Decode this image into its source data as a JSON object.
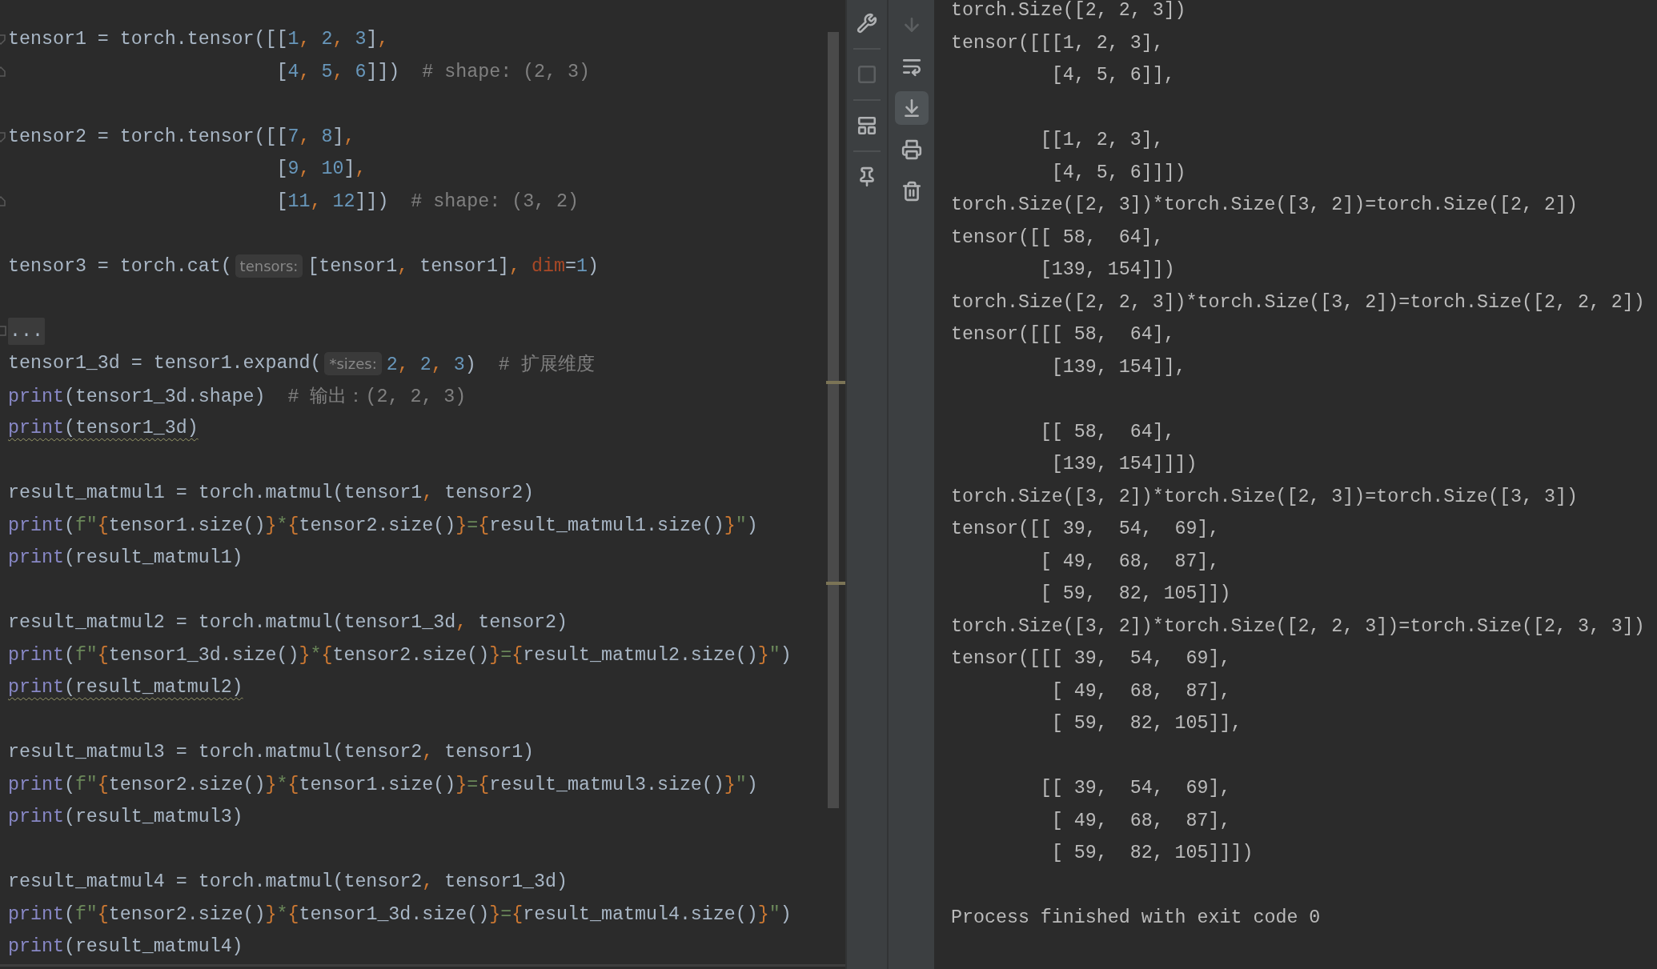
{
  "editor": {
    "lines": [
      {
        "kind": "code",
        "fold_start": true,
        "tokens": [
          {
            "kind": "plain",
            "text": "tensor1 = torch.tensor([["
          },
          {
            "kind": "number",
            "text": "1"
          },
          {
            "kind": "comma",
            "text": ", "
          },
          {
            "kind": "number",
            "text": "2"
          },
          {
            "kind": "comma",
            "text": ", "
          },
          {
            "kind": "number",
            "text": "3"
          },
          {
            "kind": "plain",
            "text": "]"
          },
          {
            "kind": "comma",
            "text": ","
          }
        ]
      },
      {
        "kind": "code",
        "fold_end": true,
        "tokens": [
          {
            "kind": "plain",
            "text": "                        ["
          },
          {
            "kind": "number",
            "text": "4"
          },
          {
            "kind": "comma",
            "text": ", "
          },
          {
            "kind": "number",
            "text": "5"
          },
          {
            "kind": "comma",
            "text": ", "
          },
          {
            "kind": "number",
            "text": "6"
          },
          {
            "kind": "plain",
            "text": "]])"
          },
          {
            "kind": "comment",
            "text": "  # shape: (2, 3)"
          }
        ]
      },
      {
        "kind": "blank"
      },
      {
        "kind": "code",
        "fold_start": true,
        "tokens": [
          {
            "kind": "plain",
            "text": "tensor2 = torch.tensor([["
          },
          {
            "kind": "number",
            "text": "7"
          },
          {
            "kind": "comma",
            "text": ", "
          },
          {
            "kind": "number",
            "text": "8"
          },
          {
            "kind": "plain",
            "text": "]"
          },
          {
            "kind": "comma",
            "text": ","
          }
        ]
      },
      {
        "kind": "code",
        "tokens": [
          {
            "kind": "plain",
            "text": "                        ["
          },
          {
            "kind": "number",
            "text": "9"
          },
          {
            "kind": "comma",
            "text": ", "
          },
          {
            "kind": "number",
            "text": "10"
          },
          {
            "kind": "plain",
            "text": "]"
          },
          {
            "kind": "comma",
            "text": ","
          }
        ]
      },
      {
        "kind": "code",
        "fold_end": true,
        "tokens": [
          {
            "kind": "plain",
            "text": "                        ["
          },
          {
            "kind": "number",
            "text": "11"
          },
          {
            "kind": "comma",
            "text": ", "
          },
          {
            "kind": "number",
            "text": "12"
          },
          {
            "kind": "plain",
            "text": "]])"
          },
          {
            "kind": "comment",
            "text": "  # shape: (3, 2)"
          }
        ]
      },
      {
        "kind": "blank"
      },
      {
        "kind": "code",
        "tokens": [
          {
            "kind": "plain",
            "text": "tensor3 = torch.cat("
          },
          {
            "kind": "hint",
            "text": "tensors:"
          },
          {
            "kind": "plain",
            "text": "[tensor1"
          },
          {
            "kind": "comma",
            "text": ", "
          },
          {
            "kind": "plain",
            "text": "tensor1]"
          },
          {
            "kind": "comma",
            "text": ", "
          },
          {
            "kind": "param",
            "text": "dim"
          },
          {
            "kind": "plain",
            "text": "="
          },
          {
            "kind": "number",
            "text": "1"
          },
          {
            "kind": "plain",
            "text": ")"
          }
        ]
      },
      {
        "kind": "blank"
      },
      {
        "kind": "code",
        "folded": true,
        "tokens": [
          {
            "kind": "fold",
            "text": "..."
          }
        ]
      },
      {
        "kind": "code",
        "tokens": [
          {
            "kind": "plain",
            "text": "tensor1_3d = tensor1.expand("
          },
          {
            "kind": "hint",
            "text": "*sizes:"
          },
          {
            "kind": "number",
            "text": "2"
          },
          {
            "kind": "comma",
            "text": ", "
          },
          {
            "kind": "number",
            "text": "2"
          },
          {
            "kind": "comma",
            "text": ", "
          },
          {
            "kind": "number",
            "text": "3"
          },
          {
            "kind": "plain",
            "text": ")"
          },
          {
            "kind": "comment",
            "text": "  # 扩展维度"
          }
        ]
      },
      {
        "kind": "code",
        "tokens": [
          {
            "kind": "builtin",
            "text": "print"
          },
          {
            "kind": "plain",
            "text": "(tensor1_3d.shape)"
          },
          {
            "kind": "comment",
            "text": "  # 输出：(2, 2, 3)"
          }
        ]
      },
      {
        "kind": "code",
        "warning": true,
        "tokens": [
          {
            "kind": "builtin",
            "text": "print"
          },
          {
            "kind": "plain",
            "text": "(tensor1_3d)"
          }
        ]
      },
      {
        "kind": "blank"
      },
      {
        "kind": "code",
        "tokens": [
          {
            "kind": "plain",
            "text": "result_matmul1 = torch.matmul(tensor1"
          },
          {
            "kind": "comma",
            "text": ", "
          },
          {
            "kind": "plain",
            "text": "tensor2)"
          }
        ]
      },
      {
        "kind": "code",
        "tokens": [
          {
            "kind": "builtin",
            "text": "print"
          },
          {
            "kind": "plain",
            "text": "("
          },
          {
            "kind": "string",
            "text": "f\""
          },
          {
            "kind": "brace",
            "text": "{"
          },
          {
            "kind": "plain",
            "text": "tensor1.size()"
          },
          {
            "kind": "brace",
            "text": "}"
          },
          {
            "kind": "string",
            "text": "*"
          },
          {
            "kind": "brace",
            "text": "{"
          },
          {
            "kind": "plain",
            "text": "tensor2.size()"
          },
          {
            "kind": "brace",
            "text": "}"
          },
          {
            "kind": "string",
            "text": "="
          },
          {
            "kind": "brace",
            "text": "{"
          },
          {
            "kind": "plain",
            "text": "result_matmul1.size()"
          },
          {
            "kind": "brace",
            "text": "}"
          },
          {
            "kind": "string",
            "text": "\""
          },
          {
            "kind": "plain",
            "text": ")"
          }
        ]
      },
      {
        "kind": "code",
        "tokens": [
          {
            "kind": "builtin",
            "text": "print"
          },
          {
            "kind": "plain",
            "text": "(result_matmul1)"
          }
        ]
      },
      {
        "kind": "blank"
      },
      {
        "kind": "code",
        "tokens": [
          {
            "kind": "plain",
            "text": "result_matmul2 = torch.matmul(tensor1_3d"
          },
          {
            "kind": "comma",
            "text": ", "
          },
          {
            "kind": "plain",
            "text": "tensor2)"
          }
        ]
      },
      {
        "kind": "code",
        "tokens": [
          {
            "kind": "builtin",
            "text": "print"
          },
          {
            "kind": "plain",
            "text": "("
          },
          {
            "kind": "string",
            "text": "f\""
          },
          {
            "kind": "brace",
            "text": "{"
          },
          {
            "kind": "plain",
            "text": "tensor1_3d.size()"
          },
          {
            "kind": "brace",
            "text": "}"
          },
          {
            "kind": "string",
            "text": "*"
          },
          {
            "kind": "brace",
            "text": "{"
          },
          {
            "kind": "plain",
            "text": "tensor2.size()"
          },
          {
            "kind": "brace",
            "text": "}"
          },
          {
            "kind": "string",
            "text": "="
          },
          {
            "kind": "brace",
            "text": "{"
          },
          {
            "kind": "plain",
            "text": "result_matmul2.size()"
          },
          {
            "kind": "brace",
            "text": "}"
          },
          {
            "kind": "string",
            "text": "\""
          },
          {
            "kind": "plain",
            "text": ")"
          }
        ]
      },
      {
        "kind": "code",
        "warning": true,
        "tokens": [
          {
            "kind": "builtin",
            "text": "print"
          },
          {
            "kind": "plain",
            "text": "(result_matmul2)"
          }
        ]
      },
      {
        "kind": "blank"
      },
      {
        "kind": "code",
        "tokens": [
          {
            "kind": "plain",
            "text": "result_matmul3 = torch.matmul(tensor2"
          },
          {
            "kind": "comma",
            "text": ", "
          },
          {
            "kind": "plain",
            "text": "tensor1)"
          }
        ]
      },
      {
        "kind": "code",
        "tokens": [
          {
            "kind": "builtin",
            "text": "print"
          },
          {
            "kind": "plain",
            "text": "("
          },
          {
            "kind": "string",
            "text": "f\""
          },
          {
            "kind": "brace",
            "text": "{"
          },
          {
            "kind": "plain",
            "text": "tensor2.size()"
          },
          {
            "kind": "brace",
            "text": "}"
          },
          {
            "kind": "string",
            "text": "*"
          },
          {
            "kind": "brace",
            "text": "{"
          },
          {
            "kind": "plain",
            "text": "tensor1.size()"
          },
          {
            "kind": "brace",
            "text": "}"
          },
          {
            "kind": "string",
            "text": "="
          },
          {
            "kind": "brace",
            "text": "{"
          },
          {
            "kind": "plain",
            "text": "result_matmul3.size()"
          },
          {
            "kind": "brace",
            "text": "}"
          },
          {
            "kind": "string",
            "text": "\""
          },
          {
            "kind": "plain",
            "text": ")"
          }
        ]
      },
      {
        "kind": "code",
        "tokens": [
          {
            "kind": "builtin",
            "text": "print"
          },
          {
            "kind": "plain",
            "text": "(result_matmul3)"
          }
        ]
      },
      {
        "kind": "blank"
      },
      {
        "kind": "code",
        "tokens": [
          {
            "kind": "plain",
            "text": "result_matmul4 = torch.matmul(tensor2"
          },
          {
            "kind": "comma",
            "text": ", "
          },
          {
            "kind": "plain",
            "text": "tensor1_3d)"
          }
        ]
      },
      {
        "kind": "code",
        "tokens": [
          {
            "kind": "builtin",
            "text": "print"
          },
          {
            "kind": "plain",
            "text": "("
          },
          {
            "kind": "string",
            "text": "f\""
          },
          {
            "kind": "brace",
            "text": "{"
          },
          {
            "kind": "plain",
            "text": "tensor2.size()"
          },
          {
            "kind": "brace",
            "text": "}"
          },
          {
            "kind": "string",
            "text": "*"
          },
          {
            "kind": "brace",
            "text": "{"
          },
          {
            "kind": "plain",
            "text": "tensor1_3d.size()"
          },
          {
            "kind": "brace",
            "text": "}"
          },
          {
            "kind": "string",
            "text": "="
          },
          {
            "kind": "brace",
            "text": "{"
          },
          {
            "kind": "plain",
            "text": "result_matmul4.size()"
          },
          {
            "kind": "brace",
            "text": "}"
          },
          {
            "kind": "string",
            "text": "\""
          },
          {
            "kind": "plain",
            "text": ")"
          }
        ]
      },
      {
        "kind": "code",
        "tokens": [
          {
            "kind": "builtin",
            "text": "print"
          },
          {
            "kind": "plain",
            "text": "(result_matmul4)"
          }
        ]
      }
    ]
  },
  "toolbar": {
    "left": [
      {
        "kind": "wrench",
        "disabled": false
      },
      {
        "kind": "stop",
        "disabled": true
      },
      {
        "kind": "layout",
        "disabled": false
      },
      {
        "kind": "pin",
        "disabled": false
      }
    ],
    "right": [
      {
        "kind": "down",
        "disabled": true,
        "selected": false
      },
      {
        "kind": "wrap",
        "disabled": false,
        "selected": false
      },
      {
        "kind": "scroll-end",
        "disabled": false,
        "selected": true
      },
      {
        "kind": "print",
        "disabled": false,
        "selected": false
      },
      {
        "kind": "trash",
        "disabled": false,
        "selected": false
      }
    ]
  },
  "console": {
    "lines": [
      {
        "kind": "out",
        "text": "torch.Size([2, 2, 3])"
      },
      {
        "kind": "out",
        "text": "tensor([[[1, 2, 3],"
      },
      {
        "kind": "out",
        "text": "         [4, 5, 6]],"
      },
      {
        "kind": "blank"
      },
      {
        "kind": "out",
        "text": "        [[1, 2, 3],"
      },
      {
        "kind": "out",
        "text": "         [4, 5, 6]]])"
      },
      {
        "kind": "out",
        "text": "torch.Size([2, 3])*torch.Size([3, 2])=torch.Size([2, 2])"
      },
      {
        "kind": "out",
        "text": "tensor([[ 58,  64],"
      },
      {
        "kind": "out",
        "text": "        [139, 154]])"
      },
      {
        "kind": "out",
        "text": "torch.Size([2, 2, 3])*torch.Size([3, 2])=torch.Size([2, 2, 2])"
      },
      {
        "kind": "out",
        "text": "tensor([[[ 58,  64],"
      },
      {
        "kind": "out",
        "text": "         [139, 154]],"
      },
      {
        "kind": "blank"
      },
      {
        "kind": "out",
        "text": "        [[ 58,  64],"
      },
      {
        "kind": "out",
        "text": "         [139, 154]]])"
      },
      {
        "kind": "out",
        "text": "torch.Size([3, 2])*torch.Size([2, 3])=torch.Size([3, 3])"
      },
      {
        "kind": "out",
        "text": "tensor([[ 39,  54,  69],"
      },
      {
        "kind": "out",
        "text": "        [ 49,  68,  87],"
      },
      {
        "kind": "out",
        "text": "        [ 59,  82, 105]])"
      },
      {
        "kind": "out",
        "text": "torch.Size([3, 2])*torch.Size([2, 2, 3])=torch.Size([2, 3, 3])"
      },
      {
        "kind": "out",
        "text": "tensor([[[ 39,  54,  69],"
      },
      {
        "kind": "out",
        "text": "         [ 49,  68,  87],"
      },
      {
        "kind": "out",
        "text": "         [ 59,  82, 105]],"
      },
      {
        "kind": "blank"
      },
      {
        "kind": "out",
        "text": "        [[ 39,  54,  69],"
      },
      {
        "kind": "out",
        "text": "         [ 49,  68,  87],"
      },
      {
        "kind": "out",
        "text": "         [ 59,  82, 105]]])"
      },
      {
        "kind": "blank"
      },
      {
        "kind": "out",
        "text": "Process finished with exit code 0"
      }
    ]
  }
}
